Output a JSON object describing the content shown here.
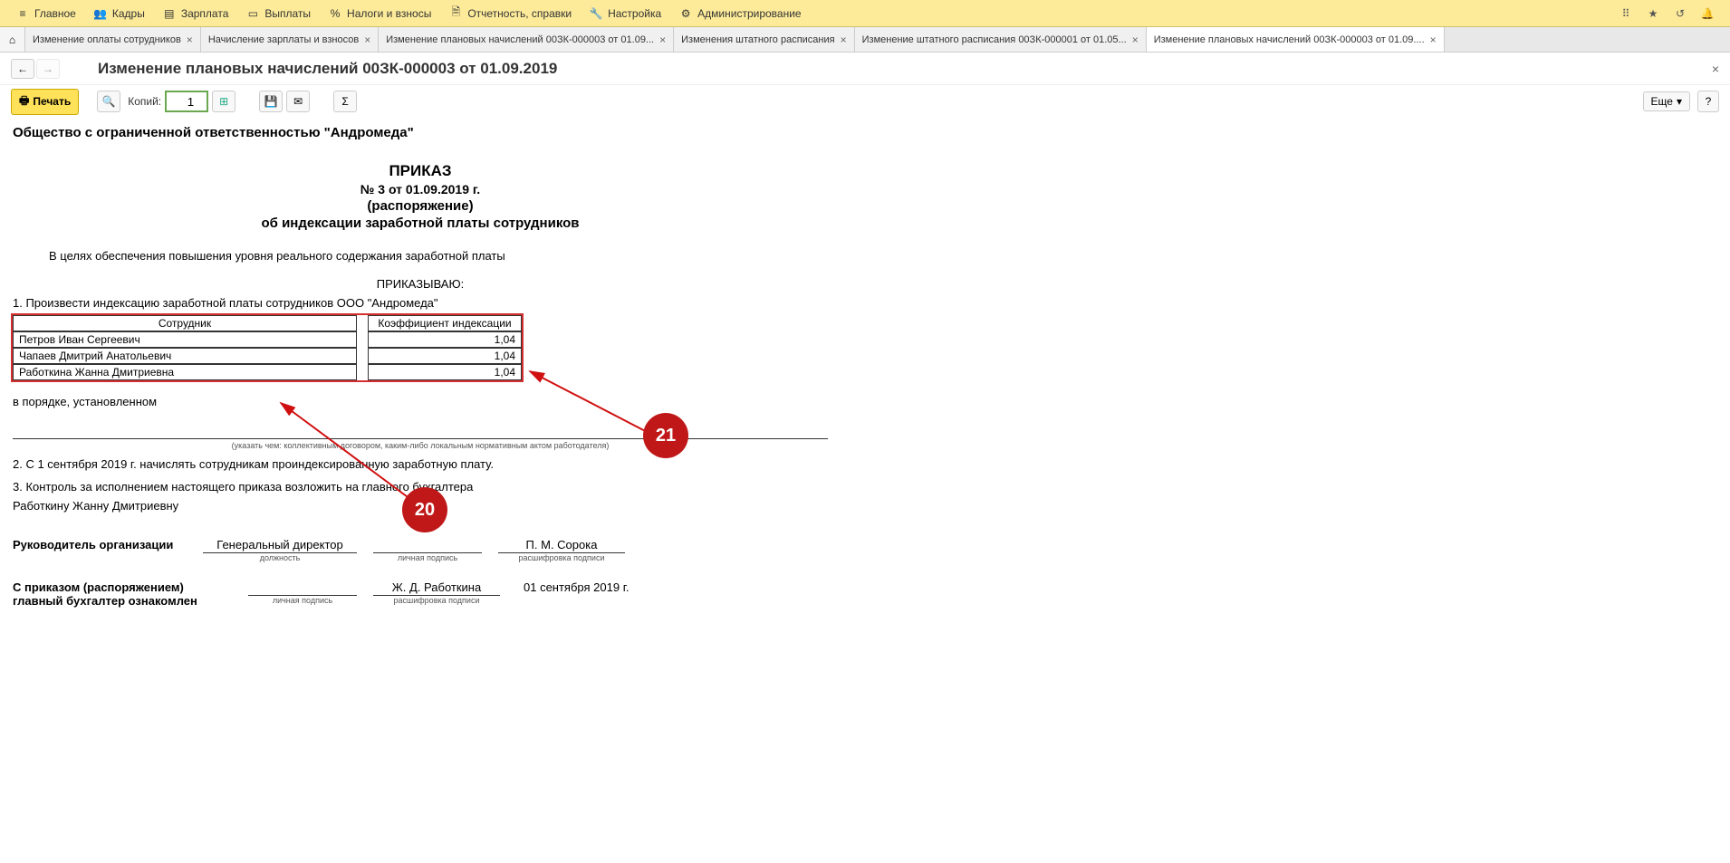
{
  "menu": {
    "items": [
      "Главное",
      "Кадры",
      "Зарплата",
      "Выплаты",
      "Налоги и взносы",
      "Отчетность, справки",
      "Настройка",
      "Администрирование"
    ]
  },
  "tabs": [
    "Изменение оплаты сотрудников",
    "Начисление зарплаты и взносов",
    "Изменение плановых начислений 00ЗК-000003 от 01.09...",
    "Изменения штатного расписания",
    "Изменение штатного расписания 00ЗК-000001 от 01.05...",
    "Изменение плановых начислений 00ЗК-000003 от 01.09...."
  ],
  "page": {
    "title": "Изменение плановых начислений 00ЗК-000003 от 01.09.2019"
  },
  "toolbar": {
    "print": "Печать",
    "copies_label": "Копий:",
    "copies_value": "1",
    "more": "Еще",
    "help": "?"
  },
  "doc": {
    "org": "Общество с ограниченной ответственностью \"Андромеда\"",
    "order_word": "ПРИКАЗ",
    "order_num": "№ 3 от 01.09.2019 г.",
    "order_sub": "(распоряжение)",
    "order_subject": "об индексации заработной платы сотрудников",
    "intro": "В целях обеспечения повышения уровня реального содержания заработной платы",
    "order_verb": "ПРИКАЗЫВАЮ:",
    "item1": "1. Произвести индексацию заработной платы сотрудников ООО \"Андромеда\"",
    "table_head_emp": "Сотрудник",
    "table_head_coef": "Коэффициент индексации",
    "rows": [
      {
        "name": "Петров Иван Сергеевич",
        "coef": "1,04"
      },
      {
        "name": "Чапаев Дмитрий Анатольевич",
        "coef": "1,04"
      },
      {
        "name": "Работкина Жанна Дмитриевна",
        "coef": "1,04"
      }
    ],
    "in_order": "в порядке, установленном",
    "hint": "(указать чем: коллективным договором, каким-либо локальным нормативным актом работодателя)",
    "item2": "2. С 1 сентября 2019 г. начислять сотрудникам проиндексированную заработную плату.",
    "item3": "3. Контроль за исполнением настоящего приказа возложить на главного бухгалтера",
    "resp_name": "Работкину Жанну Дмитриевну",
    "sig_head_label": "Руководитель организации",
    "sig_head_pos": "Генеральный директор",
    "sig_head_name": "П. М. Сорока",
    "sig_pos_hint": "должность",
    "sig_sign_hint": "личная подпись",
    "sig_name_hint": "расшифровка подписи",
    "sig_ack_label1": "С приказом (распоряжением)",
    "sig_ack_label2": "главный бухгалтер ознакомлен",
    "sig_ack_name": "Ж. Д. Работкина",
    "sig_ack_date": "01 сентября 2019 г."
  },
  "annotations": {
    "b20": "20",
    "b21": "21"
  }
}
